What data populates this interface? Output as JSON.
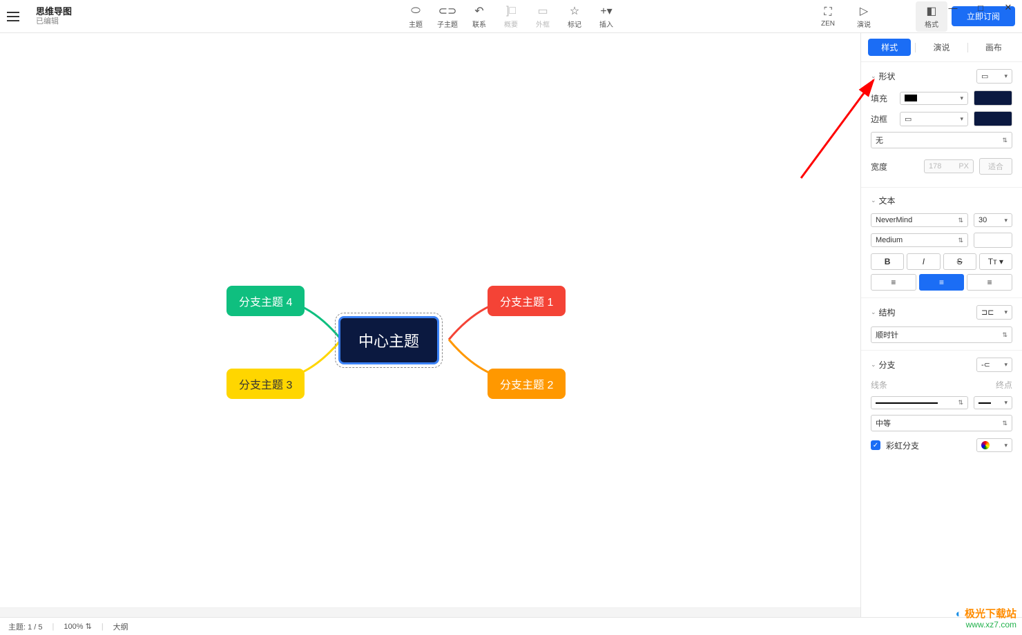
{
  "header": {
    "title": "思维导图",
    "subtitle": "已编辑"
  },
  "toolbar": {
    "topic": "主题",
    "subtopic": "子主题",
    "relation": "联系",
    "summary": "概要",
    "boundary": "外框",
    "marker": "标记",
    "insert": "插入",
    "zen": "ZEN",
    "present": "演说",
    "format": "格式",
    "subscribe": "立即订阅"
  },
  "win": {
    "min": "—",
    "max": "□",
    "close": "✕"
  },
  "mindmap": {
    "center": "中心主题",
    "b1": "分支主题 1",
    "b2": "分支主题 2",
    "b3": "分支主题 3",
    "b4": "分支主题 4"
  },
  "panel": {
    "tabs": {
      "style": "样式",
      "present": "演说",
      "canvas": "画布"
    },
    "shape": {
      "title": "形状",
      "fill": "填充",
      "border": "边框",
      "none": "无",
      "width": "宽度",
      "width_val": "178",
      "px": "PX",
      "fit": "适合"
    },
    "text": {
      "title": "文本",
      "font": "NeverMind",
      "size": "30",
      "weight": "Medium"
    },
    "structure": {
      "title": "结构",
      "direction": "顺时针"
    },
    "branch": {
      "title": "分支",
      "line": "线条",
      "endpoint": "终点",
      "thickness": "中等",
      "rainbow": "彩虹分支"
    }
  },
  "status": {
    "topics": "主题: 1 / 5",
    "zoom": "100%",
    "outline": "大纲"
  },
  "watermark": {
    "l1": "极光下载站",
    "l2": "www.xz7.com"
  }
}
